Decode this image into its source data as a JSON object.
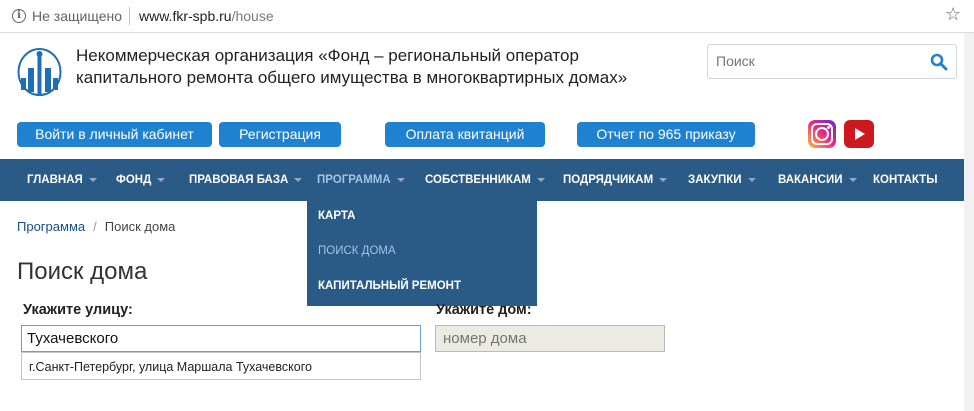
{
  "browser": {
    "security_text": "Не защищено",
    "url_host": "www.fkr-spb.ru",
    "url_path": "/house"
  },
  "header": {
    "org_title": "Некоммерческая организация «Фонд – региональный оператор капитального ремонта общего имущества в многоквартирных домах»",
    "search": {
      "placeholder": "Поиск"
    }
  },
  "buttons": {
    "login": "Войти в личный кабинет",
    "register": "Регистрация",
    "payment": "Оплата квитанций",
    "report": "Отчет по 965 приказу"
  },
  "social": [
    "instagram-icon",
    "youtube-icon"
  ],
  "nav": {
    "items": [
      {
        "label": "ГЛАВНАЯ",
        "caret": true
      },
      {
        "label": "ФОНД",
        "caret": true
      },
      {
        "label": "ПРАВОВАЯ БАЗА",
        "caret": true
      },
      {
        "label": "ПРОГРАММА",
        "caret": true,
        "active": true
      },
      {
        "label": "СОБСТВЕННИКАМ",
        "caret": true
      },
      {
        "label": "ПОДРЯДЧИКАМ",
        "caret": true
      },
      {
        "label": "ЗАКУПКИ",
        "caret": true
      },
      {
        "label": "ВАКАНСИИ",
        "caret": true
      },
      {
        "label": "КОНТАКТЫ",
        "caret": false
      }
    ],
    "dropdown": [
      {
        "label": "КАРТА"
      },
      {
        "label": "ПОИСК ДОМА",
        "active": true
      },
      {
        "label": "КАПИТАЛЬНЫЙ РЕМОНТ"
      }
    ]
  },
  "breadcrumb": {
    "parent": "Программа",
    "separator": "/",
    "current": "Поиск дома"
  },
  "page": {
    "title": "Поиск дома",
    "street_label": "Укажите улицу:",
    "street_value": "Тухачевского",
    "house_label": "Укажите дом:",
    "house_placeholder": "номер дома",
    "autocomplete_item": "г.Санкт-Петербург, улица Маршала Тухачевского"
  },
  "colors": {
    "nav_bg": "#2a5b86",
    "button_blue": "#1e82d1",
    "active_nav_text": "#9fc2e6",
    "link": "#1a4e8a"
  }
}
